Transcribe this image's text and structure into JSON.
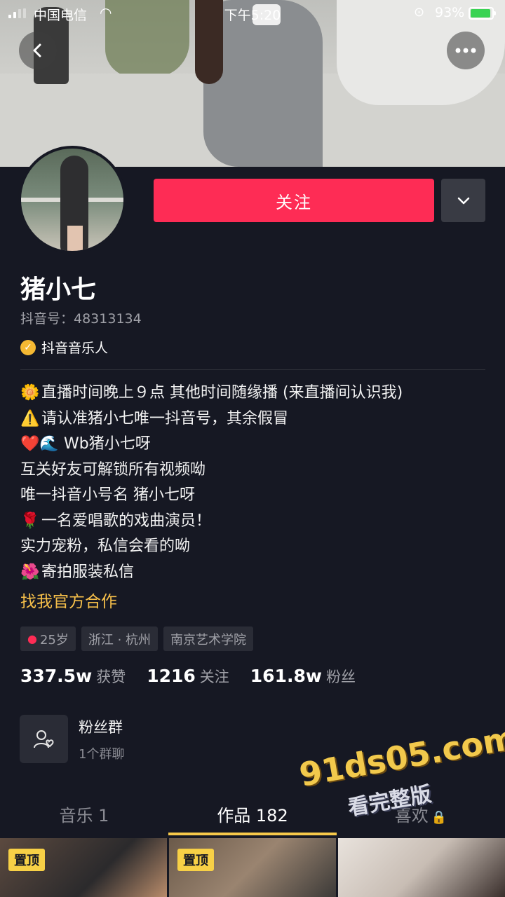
{
  "status_bar": {
    "carrier": "中国电信",
    "time": "下午5:20",
    "battery": "93%",
    "battery_level": 0.93,
    "icons": [
      "signal-icon",
      "wifi-icon",
      "orientation-lock-icon",
      "battery-icon"
    ]
  },
  "nav": {
    "back_icon": "back-icon",
    "more_icon": "more-icon"
  },
  "profile": {
    "follow_label": "关注",
    "name": "猪小七",
    "douyin_id": "抖音号：48313134",
    "verified_label": "抖音音乐人",
    "bio": [
      {
        "emoji": "🌼",
        "text": "直播时间晚上９点 其他时间随缘播 (来直播间认识我)"
      },
      {
        "emoji": "⚠️",
        "text": "请认准猪小七唯一抖音号，其余假冒"
      },
      {
        "emoji": "❤️🌊",
        "text": "Wb猪小七呀"
      },
      {
        "emoji": "",
        "text": "互关好友可解锁所有视频呦"
      },
      {
        "emoji": "",
        "text": "唯一抖音小号名 猪小七呀"
      },
      {
        "emoji": "🌹",
        "text": "一名爱唱歌的戏曲演员！"
      },
      {
        "emoji": "",
        "text": "实力宠粉，私信会看的呦"
      },
      {
        "emoji": "🌺",
        "text": "寄拍服装私信"
      }
    ],
    "cooperate": "找我官方合作",
    "tags": {
      "age": "25岁",
      "location": "浙江 · 杭州",
      "school": "南京艺术学院"
    },
    "stats": [
      {
        "num": "337.5w",
        "label": "获赞"
      },
      {
        "num": "1216",
        "label": "关注"
      },
      {
        "num": "161.8w",
        "label": "粉丝"
      }
    ],
    "fan_group": {
      "title": "粉丝群",
      "subtitle": "1个群聊"
    }
  },
  "tabs": [
    {
      "label": "音乐 1"
    },
    {
      "label": "作品 182"
    },
    {
      "label": "喜欢"
    }
  ],
  "grid": {
    "pin_label": "置顶"
  },
  "watermark": {
    "line1": "91ds05.com",
    "line2": "看完整版"
  },
  "colors": {
    "accent": "#fe2c55",
    "background": "#161823",
    "link": "#f7c04a",
    "tab_indicator": "#f7c94a"
  }
}
